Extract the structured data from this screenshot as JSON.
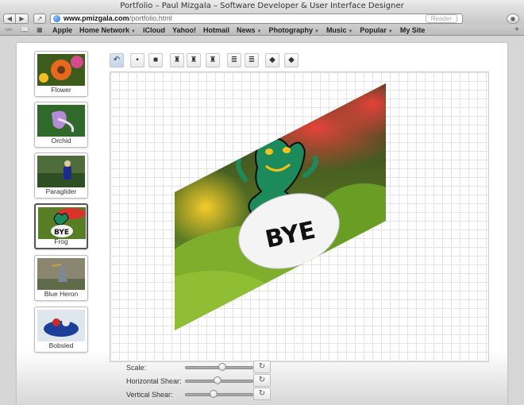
{
  "window": {
    "title": "Portfolio – Paul Mizgala – Software Developer & User Interface Designer"
  },
  "browser": {
    "url_host": "www.pmizgala.com",
    "url_path": "/portfolio.html",
    "reader_label": "Reader",
    "back_glyph": "◀",
    "forward_glyph": "▶",
    "share_glyph": "↗",
    "downloads_glyph": "◉",
    "reading_list_glyph": "👓",
    "bookmarks_glyph": "📖",
    "top_sites_glyph": "▦",
    "add_glyph": "+"
  },
  "bookmarks": [
    {
      "label": "Apple",
      "menu": false
    },
    {
      "label": "Home Network",
      "menu": true
    },
    {
      "label": "iCloud",
      "menu": false
    },
    {
      "label": "Yahoo!",
      "menu": false
    },
    {
      "label": "Hotmail",
      "menu": false
    },
    {
      "label": "News",
      "menu": true
    },
    {
      "label": "Photography",
      "menu": true
    },
    {
      "label": "Music",
      "menu": true
    },
    {
      "label": "Popular",
      "menu": true
    },
    {
      "label": "My Site",
      "menu": false
    }
  ],
  "thumbnails": [
    {
      "label": "Flower",
      "selected": false,
      "icon": "flower-thumbnail"
    },
    {
      "label": "Orchid",
      "selected": false,
      "icon": "orchid-thumbnail"
    },
    {
      "label": "Paraglider",
      "selected": false,
      "icon": "paraglider-thumbnail"
    },
    {
      "label": "Frog",
      "selected": true,
      "icon": "frog-thumbnail"
    },
    {
      "label": "Blue Heron",
      "selected": false,
      "icon": "blue-heron-thumbnail"
    },
    {
      "label": "Bobsled",
      "selected": false,
      "icon": "bobsled-thumbnail"
    }
  ],
  "tools": [
    {
      "name": "undo-tool",
      "glyph": "↶",
      "active": true
    },
    {
      "name": "tile-light-tool",
      "glyph": "▪",
      "active": false
    },
    {
      "name": "tile-dark-tool",
      "glyph": "■",
      "active": false
    },
    {
      "name": "stamp-one-tool",
      "glyph": "♜",
      "active": false
    },
    {
      "name": "stamp-two-tool",
      "glyph": "♜",
      "active": false
    },
    {
      "name": "stamp-three-tool",
      "glyph": "♜",
      "active": false
    },
    {
      "name": "page-one-tool",
      "glyph": "≣",
      "active": false
    },
    {
      "name": "page-two-tool",
      "glyph": "≣",
      "active": false
    },
    {
      "name": "cube-light-tool",
      "glyph": "◆",
      "active": false
    },
    {
      "name": "cube-dark-tool",
      "glyph": "◆",
      "active": false
    }
  ],
  "canvas_image": {
    "label": "BYE"
  },
  "controls": [
    {
      "label": "Scale:",
      "value": 0.55
    },
    {
      "label": "Horizontal Shear:",
      "value": 0.48
    },
    {
      "label": "Vertical Shear:",
      "value": 0.42
    }
  ],
  "reset_glyph": "↻",
  "colors": {
    "frog_green": "#1c8a5a",
    "foliage_green": "#6fa026",
    "bokeh_red": "#d9342b",
    "bokeh_yellow": "#f2c21c",
    "canvas_grid": "#e3e3e3"
  }
}
